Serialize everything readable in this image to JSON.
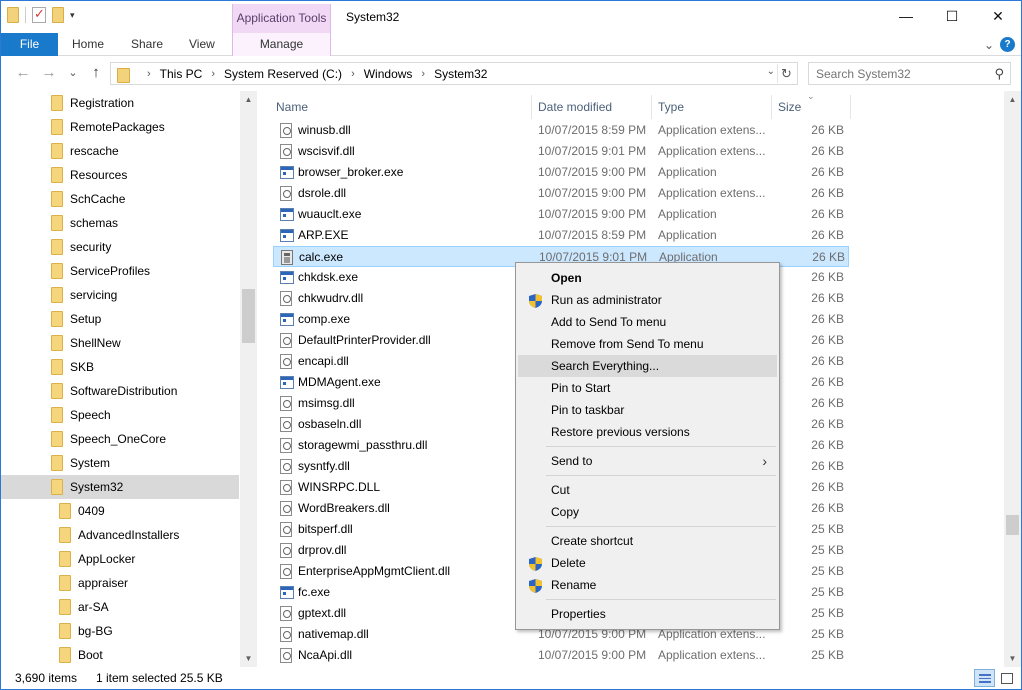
{
  "window": {
    "title": "System32",
    "contextual_tab": "Application Tools",
    "controls": {
      "minimize": "—",
      "maximize": "☐",
      "close": "✕"
    }
  },
  "ribbon": {
    "file": "File",
    "tabs": [
      "Home",
      "Share",
      "View"
    ],
    "manage": "Manage",
    "expand": "⌄",
    "help": "?"
  },
  "nav": {
    "back": "←",
    "forward": "→",
    "recent": "⌄",
    "up": "↑",
    "breadcrumbs": [
      "This PC",
      "System Reserved (C:)",
      "Windows",
      "System32"
    ],
    "crumb_sep": "›",
    "dropdown": "⌄",
    "refresh": "↻",
    "search_placeholder": "Search System32",
    "search_glyph": "⚲"
  },
  "tree": [
    {
      "label": "Registration",
      "selected": false
    },
    {
      "label": "RemotePackages",
      "selected": false
    },
    {
      "label": "rescache",
      "selected": false
    },
    {
      "label": "Resources",
      "selected": false
    },
    {
      "label": "SchCache",
      "selected": false
    },
    {
      "label": "schemas",
      "selected": false
    },
    {
      "label": "security",
      "selected": false
    },
    {
      "label": "ServiceProfiles",
      "selected": false
    },
    {
      "label": "servicing",
      "selected": false
    },
    {
      "label": "Setup",
      "selected": false
    },
    {
      "label": "ShellNew",
      "selected": false
    },
    {
      "label": "SKB",
      "selected": false
    },
    {
      "label": "SoftwareDistribution",
      "selected": false
    },
    {
      "label": "Speech",
      "selected": false
    },
    {
      "label": "Speech_OneCore",
      "selected": false
    },
    {
      "label": "System",
      "selected": false
    },
    {
      "label": "System32",
      "selected": true
    },
    {
      "label": "0409",
      "selected": false,
      "child": true
    },
    {
      "label": "AdvancedInstallers",
      "selected": false,
      "child": true
    },
    {
      "label": "AppLocker",
      "selected": false,
      "child": true
    },
    {
      "label": "appraiser",
      "selected": false,
      "child": true
    },
    {
      "label": "ar-SA",
      "selected": false,
      "child": true
    },
    {
      "label": "bg-BG",
      "selected": false,
      "child": true
    },
    {
      "label": "Boot",
      "selected": false,
      "child": true
    }
  ],
  "columns": {
    "name": "Name",
    "date": "Date modified",
    "type": "Type",
    "size": "Size",
    "sort_arrow": "⌄"
  },
  "files": [
    {
      "name": "winusb.dll",
      "date": "10/07/2015 8:59 PM",
      "type": "Application extens...",
      "size": "26 KB",
      "icon": "dll"
    },
    {
      "name": "wscisvif.dll",
      "date": "10/07/2015 9:01 PM",
      "type": "Application extens...",
      "size": "26 KB",
      "icon": "dll"
    },
    {
      "name": "browser_broker.exe",
      "date": "10/07/2015 9:00 PM",
      "type": "Application",
      "size": "26 KB",
      "icon": "exe"
    },
    {
      "name": "dsrole.dll",
      "date": "10/07/2015 9:00 PM",
      "type": "Application extens...",
      "size": "26 KB",
      "icon": "dll"
    },
    {
      "name": "wuauclt.exe",
      "date": "10/07/2015 9:00 PM",
      "type": "Application",
      "size": "26 KB",
      "icon": "exe"
    },
    {
      "name": "ARP.EXE",
      "date": "10/07/2015 8:59 PM",
      "type": "Application",
      "size": "26 KB",
      "icon": "exe"
    },
    {
      "name": "calc.exe",
      "date": "10/07/2015 9:01 PM",
      "type": "Application",
      "size": "26 KB",
      "icon": "calc",
      "selected": true
    },
    {
      "name": "chkdsk.exe",
      "date": "",
      "type": "",
      "size": "26 KB",
      "icon": "exe"
    },
    {
      "name": "chkwudrv.dll",
      "date": "",
      "type": "",
      "size": "26 KB",
      "icon": "dll"
    },
    {
      "name": "comp.exe",
      "date": "",
      "type": "",
      "size": "26 KB",
      "icon": "exe"
    },
    {
      "name": "DefaultPrinterProvider.dll",
      "date": "",
      "type": "",
      "size": "26 KB",
      "icon": "dll"
    },
    {
      "name": "encapi.dll",
      "date": "",
      "type": "",
      "size": "26 KB",
      "icon": "dll"
    },
    {
      "name": "MDMAgent.exe",
      "date": "",
      "type": "",
      "size": "26 KB",
      "icon": "exe"
    },
    {
      "name": "msimsg.dll",
      "date": "",
      "type": "",
      "size": "26 KB",
      "icon": "dll"
    },
    {
      "name": "osbaseln.dll",
      "date": "",
      "type": "",
      "size": "26 KB",
      "icon": "dll"
    },
    {
      "name": "storagewmi_passthru.dll",
      "date": "",
      "type": "",
      "size": "26 KB",
      "icon": "dll"
    },
    {
      "name": "sysntfy.dll",
      "date": "",
      "type": "",
      "size": "26 KB",
      "icon": "dll"
    },
    {
      "name": "WINSRPC.DLL",
      "date": "",
      "type": "",
      "size": "26 KB",
      "icon": "dll"
    },
    {
      "name": "WordBreakers.dll",
      "date": "",
      "type": "",
      "size": "26 KB",
      "icon": "dll"
    },
    {
      "name": "bitsperf.dll",
      "date": "",
      "type": "",
      "size": "25 KB",
      "icon": "dll"
    },
    {
      "name": "drprov.dll",
      "date": "",
      "type": "",
      "size": "25 KB",
      "icon": "dll"
    },
    {
      "name": "EnterpriseAppMgmtClient.dll",
      "date": "",
      "type": "",
      "size": "25 KB",
      "icon": "dll"
    },
    {
      "name": "fc.exe",
      "date": "",
      "type": "",
      "size": "25 KB",
      "icon": "exe"
    },
    {
      "name": "gptext.dll",
      "date": "",
      "type": "",
      "size": "25 KB",
      "icon": "dll"
    },
    {
      "name": "nativemap.dll",
      "date": "10/07/2015 9:00 PM",
      "type": "Application extens...",
      "size": "25 KB",
      "icon": "dll"
    },
    {
      "name": "NcaApi.dll",
      "date": "10/07/2015 9:00 PM",
      "type": "Application extens...",
      "size": "25 KB",
      "icon": "dll"
    }
  ],
  "context_menu": [
    {
      "label": "Open",
      "bold": true
    },
    {
      "label": "Run as administrator",
      "shield": true
    },
    {
      "label": "Add to Send To menu"
    },
    {
      "label": "Remove from Send To menu"
    },
    {
      "label": "Search Everything...",
      "hover": true
    },
    {
      "label": "Pin to Start"
    },
    {
      "label": "Pin to taskbar"
    },
    {
      "label": "Restore previous versions"
    },
    {
      "separator": true
    },
    {
      "label": "Send to",
      "submenu": true,
      "submenu_glyph": "›"
    },
    {
      "separator": true
    },
    {
      "label": "Cut"
    },
    {
      "label": "Copy"
    },
    {
      "separator": true
    },
    {
      "label": "Create shortcut"
    },
    {
      "label": "Delete",
      "shield": true
    },
    {
      "label": "Rename",
      "shield": true
    },
    {
      "separator": true
    },
    {
      "label": "Properties"
    }
  ],
  "status": {
    "items": "3,690 items",
    "selected": "1 item selected  25.5 KB"
  },
  "colors": {
    "accent": "#1979ca",
    "selection": "#cce8ff",
    "contextual_tab": "#f1d9f5"
  }
}
